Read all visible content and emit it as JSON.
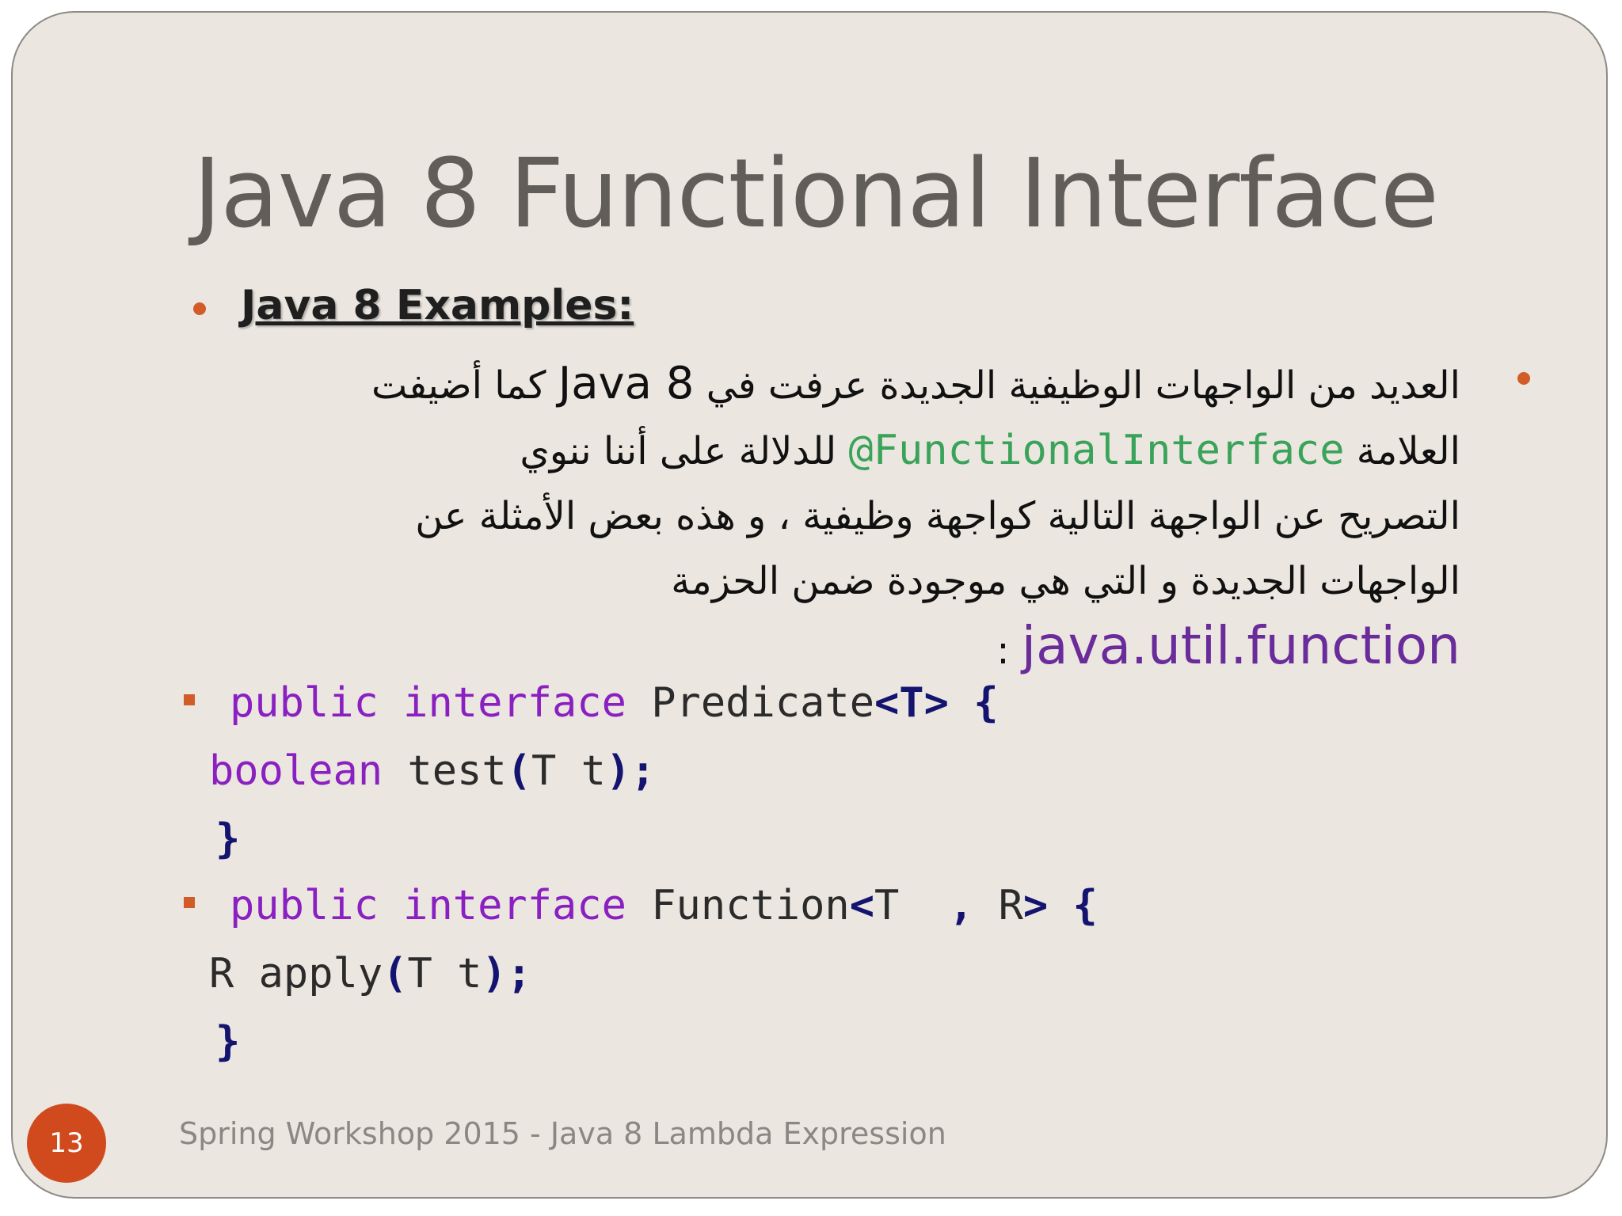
{
  "slide": {
    "title": "Java 8 Functional Interface",
    "subheading": "Java 8 Examples:",
    "arabic": {
      "l1_a": "العديد من الواجهات الوظيفية الجديدة عرفت في",
      "l1_java": "Java 8",
      "l1_b": "كما أضيفت",
      "l2_a": "العلامة",
      "l2_annot": "@FunctionalInterface",
      "l2_b": "للدلالة على أننا ننوي",
      "l3": "التصريح عن الواجهة التالية كواجهة وظيفية ، و هذه بعض الأمثلة عن",
      "l4": "الواجهات الجديدة و التي هي موجودة ضمن الحزمة",
      "l5_package": "java.util.function",
      "l5_colon": ":"
    },
    "code1": {
      "kw1": "public",
      "kw2": "interface",
      "name": "Predicate",
      "generic": "<T>",
      "open": "{",
      "ret": "boolean",
      "method": "test",
      "lparen": "(",
      "params": "T t",
      "rparen": ")",
      "semi": ";",
      "close": "}"
    },
    "code2": {
      "kw1": "public",
      "kw2": "interface",
      "name": "Function",
      "lt": "<",
      "t": "T",
      "comma": ",",
      "r": "R",
      "gt": ">",
      "open": "{",
      "ret": "R",
      "method": "apply",
      "lparen": "(",
      "params": "T t",
      "rparen": ")",
      "semi": ";",
      "close": "}"
    },
    "footer": {
      "page_number": "13",
      "text": "Spring Workshop 2015 - Java 8 Lambda Expression"
    },
    "colors": {
      "background": "#ebe6df",
      "accent": "#d25c28",
      "keyword": "#8a1fc2",
      "annotation": "#3aa35a",
      "package": "#6a2c9a"
    }
  }
}
